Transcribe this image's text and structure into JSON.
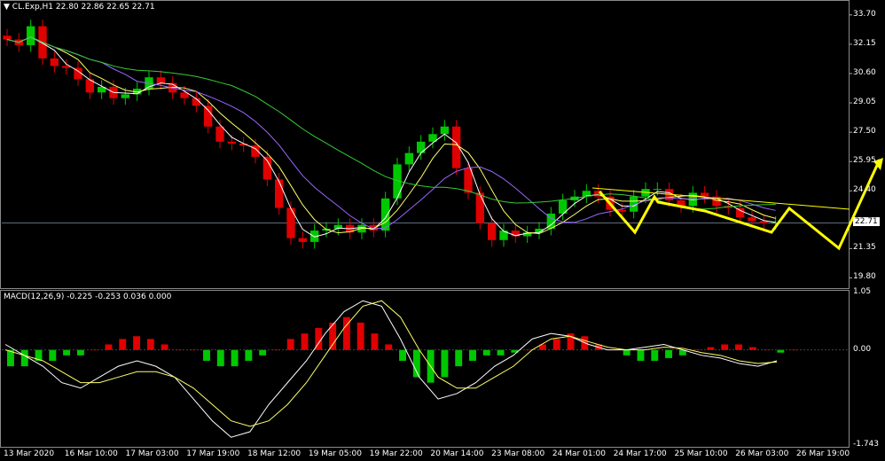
{
  "header": {
    "marker": "▼",
    "text": "CL.Exp,H1  22.80 22.86 22.65 22.71"
  },
  "macd_header": {
    "text": "MACD(12,26,9) -0.225 -0.253 0.036 0.000"
  },
  "price_scale": [
    "33.70",
    "32.15",
    "30.60",
    "29.05",
    "27.50",
    "25.95",
    "24.40",
    "22.71",
    "21.35",
    "19.80"
  ],
  "macd_scale": [
    "1.05",
    "0.00",
    "-1.743"
  ],
  "time_axis": [
    "13 Mar 2020",
    "16 Mar 10:00",
    "17 Mar 03:00",
    "17 Mar 19:00",
    "18 Mar 12:00",
    "19 Mar 05:00",
    "19 Mar 22:00",
    "20 Mar 14:00",
    "23 Mar 08:00",
    "24 Mar 01:00",
    "24 Mar 17:00",
    "25 Mar 10:00",
    "26 Mar 03:00",
    "26 Mar 19:00"
  ],
  "colors": {
    "bull": "#00c800",
    "bear": "#e00000",
    "ma_fast": "#ffffff",
    "ma_mid": "#ffff66",
    "ma_slow": "#9966ff",
    "ma_long": "#33cc33",
    "arrow": "#ffff00",
    "current_price_bg": "#ffffff"
  },
  "chart_data": [
    {
      "type": "line",
      "title": "CL.Exp,H1",
      "ohlc_last": {
        "open": 22.8,
        "high": 22.86,
        "low": 22.65,
        "close": 22.71
      },
      "ylim": [
        19.4,
        34.3
      ],
      "current_price": 22.71,
      "x_ticks": [
        "13 Mar 2020",
        "16 Mar 10:00",
        "17 Mar 03:00",
        "17 Mar 19:00",
        "18 Mar 12:00",
        "19 Mar 05:00",
        "19 Mar 22:00",
        "20 Mar 14:00",
        "23 Mar 08:00",
        "24 Mar 01:00",
        "24 Mar 17:00",
        "25 Mar 10:00",
        "26 Mar 03:00",
        "26 Mar 19:00"
      ],
      "closes": [
        32.4,
        32.1,
        33.1,
        31.4,
        31.0,
        30.9,
        30.3,
        29.6,
        29.9,
        29.3,
        29.5,
        29.8,
        30.4,
        30.1,
        29.6,
        29.3,
        28.9,
        27.8,
        27.0,
        26.9,
        26.8,
        26.2,
        25.0,
        23.5,
        21.9,
        21.7,
        22.3,
        22.4,
        22.6,
        22.2,
        22.6,
        22.3,
        24.0,
        25.8,
        26.4,
        27.0,
        27.4,
        27.8,
        25.6,
        24.3,
        22.7,
        21.8,
        22.3,
        22.0,
        22.2,
        22.4,
        23.2,
        23.9,
        24.1,
        24.4,
        24.1,
        23.4,
        23.3,
        24.1,
        24.5,
        24.5,
        23.9,
        23.6,
        24.3,
        24.1,
        23.6,
        23.5,
        23.0,
        22.8,
        22.7,
        22.71
      ]
    },
    {
      "type": "bar",
      "title": "MACD(12,26,9)",
      "values_label": [
        -0.225,
        -0.253,
        0.036,
        0.0
      ],
      "ylim": [
        -1.743,
        1.05
      ],
      "histogram": [
        -0.3,
        -0.3,
        -0.2,
        -0.2,
        -0.1,
        -0.1,
        0.0,
        0.1,
        0.2,
        0.25,
        0.2,
        0.1,
        0.0,
        0.0,
        -0.2,
        -0.3,
        -0.3,
        -0.2,
        -0.1,
        0.0,
        0.2,
        0.3,
        0.4,
        0.5,
        0.6,
        0.5,
        0.3,
        0.1,
        -0.2,
        -0.5,
        -0.6,
        -0.5,
        -0.3,
        -0.2,
        -0.1,
        -0.1,
        -0.05,
        0.0,
        0.1,
        0.2,
        0.3,
        0.25,
        0.1,
        0.0,
        -0.1,
        -0.2,
        -0.2,
        -0.15,
        -0.1,
        0.0,
        0.05,
        0.1,
        0.1,
        0.05,
        0.0,
        -0.05,
        0.0
      ],
      "macd_line": [
        0.1,
        -0.1,
        -0.3,
        -0.6,
        -0.7,
        -0.5,
        -0.3,
        -0.2,
        -0.3,
        -0.5,
        -0.9,
        -1.3,
        -1.6,
        -1.5,
        -1.0,
        -0.6,
        -0.2,
        0.3,
        0.7,
        0.9,
        0.8,
        0.2,
        -0.5,
        -0.9,
        -0.8,
        -0.6,
        -0.3,
        -0.1,
        0.2,
        0.3,
        0.25,
        0.1,
        0.0,
        0.0,
        0.05,
        0.1,
        0.0,
        -0.1,
        -0.15,
        -0.25,
        -0.3,
        -0.2
      ],
      "signal_line": [
        0.0,
        -0.1,
        -0.2,
        -0.4,
        -0.6,
        -0.6,
        -0.5,
        -0.4,
        -0.4,
        -0.5,
        -0.7,
        -1.0,
        -1.3,
        -1.4,
        -1.3,
        -1.0,
        -0.6,
        -0.1,
        0.4,
        0.8,
        0.9,
        0.6,
        0.0,
        -0.5,
        -0.7,
        -0.7,
        -0.5,
        -0.3,
        0.0,
        0.2,
        0.25,
        0.15,
        0.05,
        0.0,
        0.0,
        0.05,
        0.03,
        -0.05,
        -0.1,
        -0.2,
        -0.25,
        -0.22
      ]
    }
  ]
}
